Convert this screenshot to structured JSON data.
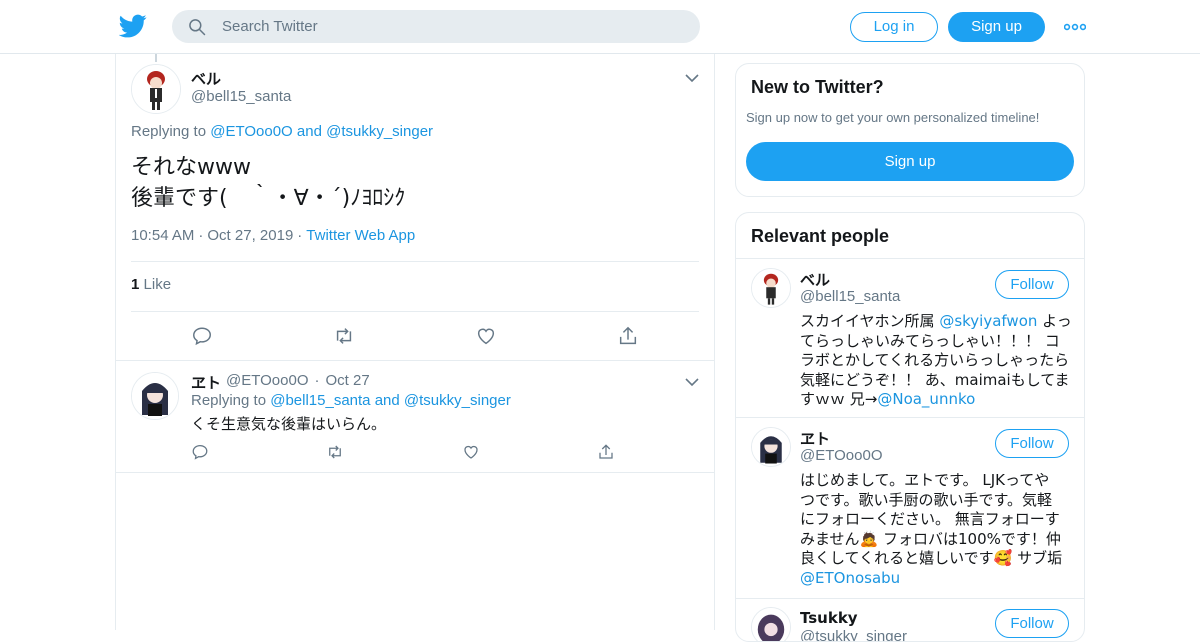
{
  "header": {
    "search_placeholder": "Search Twitter",
    "login_label": "Log in",
    "signup_label": "Sign up"
  },
  "tweet": {
    "author_name": "ベル",
    "author_handle": "@bell15_santa",
    "replying_prefix": "Replying to ",
    "replying_to_1": "@ETOoo0O",
    "replying_and": " and ",
    "replying_to_2": "@tsukky_singer",
    "text_line1": "それなwww",
    "text_line2": "後輩です(　｀・∀・´)ﾉﾖﾛｼｸ",
    "time": "10:54 AM",
    "date": "Oct 27, 2019",
    "source": "Twitter Web App",
    "like_count": "1",
    "like_label": "Like"
  },
  "reply": {
    "author_name": "ヱト",
    "author_handle": "@ETOoo0O",
    "date": "Oct 27",
    "replying_prefix": "Replying to ",
    "replying_to_1": "@bell15_santa",
    "replying_and": " and ",
    "replying_to_2": "@tsukky_singer",
    "text": "くそ生意気な後輩はいらん。"
  },
  "new_to_twitter": {
    "title": "New to Twitter?",
    "subtitle": "Sign up now to get your own personalized timeline!",
    "signup_label": "Sign up"
  },
  "relevant_people": {
    "title": "Relevant people",
    "follow_label": "Follow",
    "people": [
      {
        "name": "ベル",
        "handle": "@bell15_santa",
        "bio_1": "スカイイヤホン所属 ",
        "bio_link_1": "@skyiyafwon",
        "bio_2": " よっ\nてらっしゃいみてらっしゃい！！！ コ\nラボとかしてくれる方いらっしゃったら\n気軽にどうぞ！！ あ、maimaiもしてま\nすｗｗ 兄→",
        "bio_link_2": "@Noa_unnko"
      },
      {
        "name": "ヱト",
        "handle": "@ETOoo0O",
        "bio_1": "はじめまして。ヱトです。 LJKってや\nつです。歌い手厨の歌い手です。気軽\nにフォローください。 無言フォローす\nみません🙇 フォロバは100%です！仲\n良くしてくれると嬉しいです🥰 サブ垢\n",
        "bio_link_1": "@ETOnosabu"
      },
      {
        "name": "Tsukky",
        "handle": "@tsukky_singer"
      }
    ]
  },
  "colors": {
    "brand_blue": "#1da1f2",
    "link_blue": "#1b95e0",
    "secondary_text": "#657786",
    "border": "#e6ecf0"
  }
}
